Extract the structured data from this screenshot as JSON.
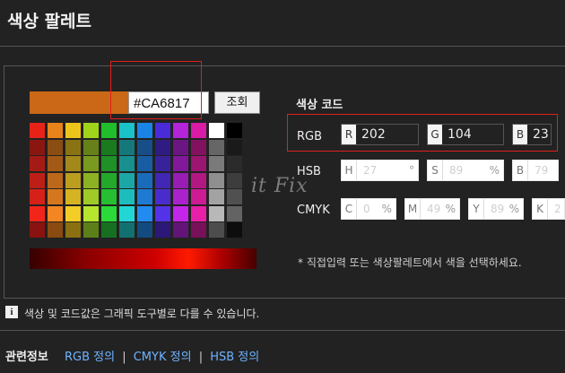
{
  "page_title": "색상 팔레트",
  "picker": {
    "current_hex": "#CA6817",
    "swatch_color": "#CA6817",
    "lookup_label": "조회"
  },
  "palette": {
    "rows": [
      [
        "#e72318",
        "#e7831a",
        "#ecc51a",
        "#a0d31b",
        "#20be2a",
        "#19c3c7",
        "#1a84e6",
        "#4a2bd9",
        "#b424d9",
        "#d91ba5",
        "#ffffff",
        "#000000"
      ],
      [
        "#8a1612",
        "#8a4d12",
        "#8a7312",
        "#66811a",
        "#1a7a1f",
        "#15797c",
        "#174e88",
        "#2f1c82",
        "#6b1682",
        "#82125f",
        "#666666",
        "#1a1a1a"
      ],
      [
        "#a41b15",
        "#a35a17",
        "#a3891a",
        "#7a9a1f",
        "#1f9127",
        "#18908f",
        "#185da2",
        "#38229b",
        "#82199b",
        "#9b1571",
        "#7a7a7a",
        "#2b2b2b"
      ],
      [
        "#bd1f17",
        "#bc681b",
        "#bc9e1f",
        "#8cb223",
        "#23a82c",
        "#1ca7a6",
        "#1b6bbb",
        "#4127b4",
        "#971db4",
        "#b31882",
        "#8f8f8f",
        "#3d3d3d"
      ],
      [
        "#d52119",
        "#d5771e",
        "#d5b322",
        "#9fca27",
        "#26bf31",
        "#1ebdbd",
        "#1e7ad3",
        "#4a2ccc",
        "#ab21cc",
        "#cc1b93",
        "#a3a3a3",
        "#505050"
      ],
      [
        "#f2251b",
        "#f38622",
        "#f2cc27",
        "#b5e52c",
        "#2bd939",
        "#22d6d6",
        "#228bef",
        "#5432e8",
        "#c326e8",
        "#e81fa7",
        "#b8b8b8",
        "#636363"
      ],
      [
        "#8a1210",
        "#8a4a10",
        "#8a7010",
        "#5c7f18",
        "#177021",
        "#137070",
        "#134a80",
        "#2c1878",
        "#621478",
        "#78105a",
        "#4d4d4d",
        "#0d0d0d"
      ]
    ]
  },
  "code": {
    "title": "색상 코드",
    "rgb": {
      "label": "RGB",
      "r_letter": "R",
      "r": "202",
      "g_letter": "G",
      "g": "104",
      "b_letter": "B",
      "b": "23"
    },
    "hsb": {
      "label": "HSB",
      "h_letter": "H",
      "h": "27",
      "h_unit": "°",
      "s_letter": "S",
      "s": "89",
      "s_unit": "%",
      "b_letter": "B",
      "b": "79"
    },
    "cmyk": {
      "label": "CMYK",
      "c_letter": "C",
      "c": "0",
      "c_unit": "%",
      "m_letter": "M",
      "m": "49",
      "m_unit": "%",
      "y_letter": "Y",
      "y": "89",
      "y_unit": "%",
      "k_letter": "K",
      "k": "2"
    }
  },
  "note": "* 직접입력 또는 색상팔레트에서 색을 선택하세요.",
  "info": {
    "icon": "info-icon",
    "text": "색상 및 코드값은 그래픽 도구별로 다를 수 있습니다."
  },
  "related": {
    "label": "관련정보",
    "links": [
      "RGB 정의",
      "CMYK 정의",
      "HSB 정의"
    ],
    "separator": "|"
  },
  "watermark": "it Fix",
  "colors": {
    "accent_link": "#6fb3ff",
    "highlight_box": "#e0201c"
  }
}
